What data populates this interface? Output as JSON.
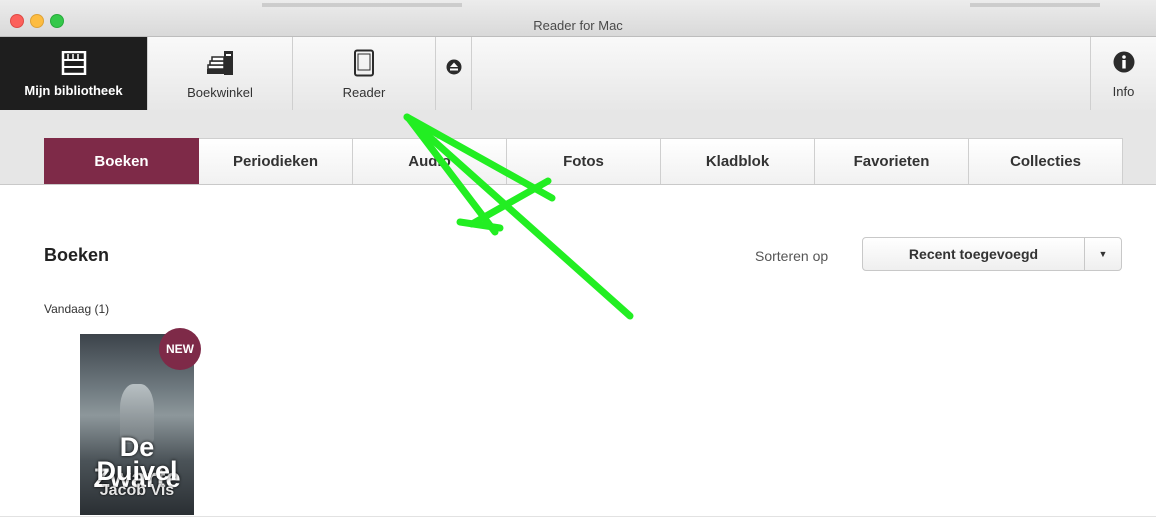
{
  "window": {
    "title": "Reader for Mac"
  },
  "toolbar": {
    "library_label": "Mijn bibliotheek",
    "store_label": "Boekwinkel",
    "reader_label": "Reader",
    "info_label": "Info"
  },
  "tabs": [
    {
      "label": "Boeken"
    },
    {
      "label": "Periodieken"
    },
    {
      "label": "Audio"
    },
    {
      "label": "Fotos"
    },
    {
      "label": "Kladblok"
    },
    {
      "label": "Favorieten"
    },
    {
      "label": "Collecties"
    }
  ],
  "main": {
    "section_title": "Boeken",
    "sort_label": "Sorteren op",
    "sort_value": "Recent toegevoegd",
    "group_label": "Vandaag (1)"
  },
  "book": {
    "title_line1": "De Zwarte",
    "title_line2": "Duivel",
    "author": "Jacob Vis",
    "badge": "NEW"
  },
  "colors": {
    "accent": "#7e2a48",
    "toolbar_active": "#1e1e1e",
    "annotation": "#22ee22"
  },
  "icons": {
    "library": "bookshelf-icon",
    "store": "books-stack-icon",
    "reader": "tablet-icon",
    "eject": "eject-icon",
    "info": "info-icon",
    "sort_arrow": "chevron-down-icon"
  }
}
